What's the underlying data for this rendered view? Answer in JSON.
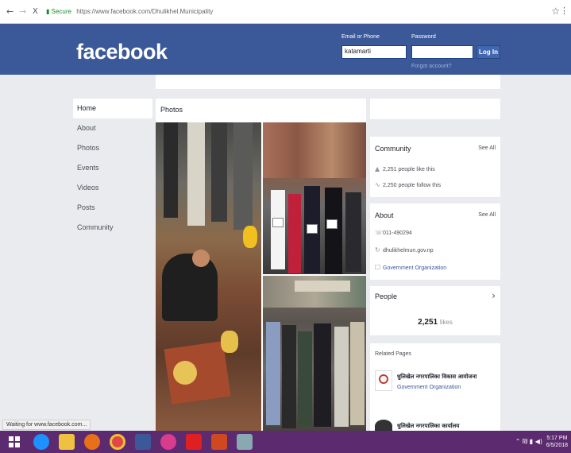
{
  "browser": {
    "back": "←",
    "forward": "→",
    "stop": "X",
    "secure_label": "Secure",
    "url": "https://www.facebook.com/Dhulikhel.Municipality",
    "star": "☆",
    "menu": "⋮"
  },
  "header": {
    "logo": "facebook",
    "email_label": "Email or Phone",
    "password_label": "Password",
    "email_value": "katamarti",
    "login_button": "Log In",
    "forgot_link": "Forgot account?"
  },
  "leftnav": {
    "items": [
      {
        "label": "Home"
      },
      {
        "label": "About"
      },
      {
        "label": "Photos"
      },
      {
        "label": "Events"
      },
      {
        "label": "Videos"
      },
      {
        "label": "Posts"
      },
      {
        "label": "Community"
      }
    ]
  },
  "photos": {
    "title": "Photos"
  },
  "community": {
    "title": "Community",
    "see_all": "See All",
    "likes_text": "2,251 people like this",
    "follows_text": "2,250 people follow this"
  },
  "about": {
    "title": "About",
    "see_all": "See All",
    "phone": "011-490294",
    "website": "dhulikhelmun.gov.np",
    "category": "Government Organization"
  },
  "people": {
    "title": "People",
    "chevron": "›",
    "likes_count": "2,251",
    "likes_suffix": "likes"
  },
  "related": {
    "title": "Related Pages",
    "items": [
      {
        "name": "धुलिखेल नगरपालिका विकास आयोजना",
        "category": "Government Organization"
      },
      {
        "name": "धुलिखेल नगरपालिका कार्यालय",
        "category": ""
      }
    ]
  },
  "statusbar": {
    "text": "Waiting for www.facebook.com..."
  },
  "taskbar": {
    "tray_text": "⌃ ₪ ▮ ◀)",
    "time": "5:17 PM",
    "date": "6/5/2018"
  },
  "colors": {
    "fb_blue": "#3b5998",
    "taskbar": "#5c2a6e",
    "page_bg": "#e9ebee"
  }
}
